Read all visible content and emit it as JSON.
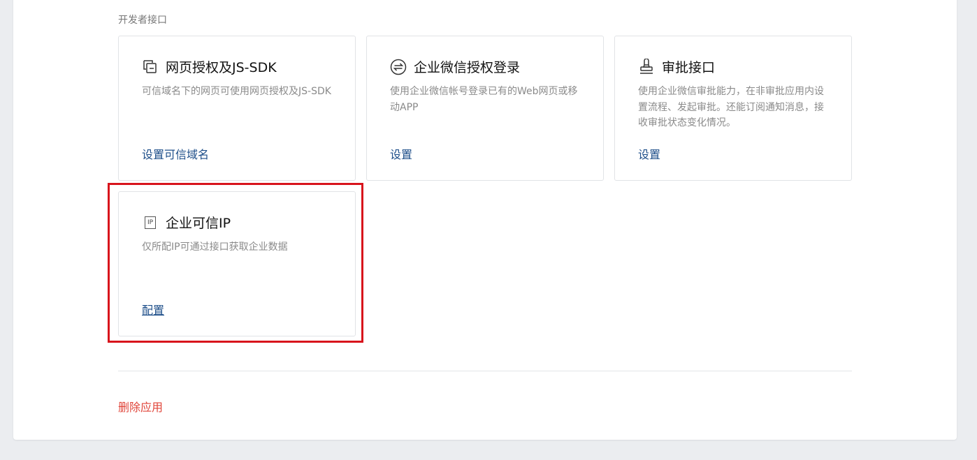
{
  "section": {
    "title": "开发者接口"
  },
  "cards": [
    {
      "title": "网页授权及JS-SDK",
      "description": "可信域名下的网页可使用网页授权及JS-SDK",
      "action": "设置可信域名",
      "icon": "copy-window-icon"
    },
    {
      "title": "企业微信授权登录",
      "description": "使用企业微信帐号登录已有的Web网页或移动APP",
      "action": "设置",
      "icon": "circle-transfer-icon"
    },
    {
      "title": "审批接口",
      "description": "使用企业微信审批能力，在非审批应用内设置流程、发起审批。还能订阅通知消息，接收审批状态变化情况。",
      "action": "设置",
      "icon": "stamp-icon"
    },
    {
      "title": "企业可信IP",
      "description": "仅所配IP可通过接口获取企业数据",
      "action": "配置",
      "icon": "ip-badge-icon",
      "icon_text": "IP"
    }
  ],
  "footer": {
    "delete_label": "删除应用"
  },
  "colors": {
    "link": "#1d4e89",
    "danger": "#e0453a",
    "highlight": "#d8141c"
  }
}
